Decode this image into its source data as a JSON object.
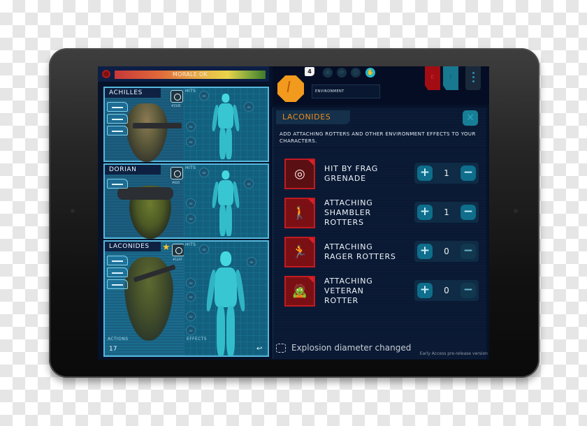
{
  "morale": {
    "label": "MORALE OK"
  },
  "characters": [
    {
      "name": "ACHILLES",
      "perk_id": "#1545",
      "starred": false,
      "weapons": [
        "pistol",
        "assault-rifle",
        "sniper-rifle"
      ],
      "hits_label": "HITS"
    },
    {
      "name": "DORIAN",
      "perk_id": "#635",
      "starred": false,
      "weapons": [
        "pistol"
      ],
      "hits_label": "HITS"
    },
    {
      "name": "LACONIDES",
      "perk_id": "#1247",
      "starred": true,
      "weapons": [
        "assault-rifle",
        "pistol",
        "sniper-rifle"
      ],
      "hits_label": "HITS",
      "actions_label": "ACTIONS",
      "actions_value": "17",
      "effects_label": "EFFECTS"
    }
  ],
  "topbar": {
    "action_points": "4",
    "environment_label": "ENVIRONMENT",
    "tool_icons": [
      "grenade-icon",
      "refresh-icon",
      "character-icon",
      "hand-icon"
    ],
    "flags": [
      {
        "label": "E",
        "color": "#a10d13"
      },
      {
        "label": "!",
        "color": "#17788f"
      }
    ]
  },
  "panel": {
    "title": "LACONIDES",
    "description": "ADD ATTACHING ROTTERS AND OTHER ENVIRONMENT EFFECTS TO YOUR CHARACTERS.",
    "effects": [
      {
        "label_lines": [
          "HIT BY FRAG",
          "GRENADE"
        ],
        "value": "1",
        "icon": "frag-grenade-icon"
      },
      {
        "label_lines": [
          "ATTACHING",
          "SHAMBLER",
          "ROTTERS"
        ],
        "value": "1",
        "icon": "shambler-rotter-icon"
      },
      {
        "label_lines": [
          "ATTACHING",
          "RAGER ROTTERS"
        ],
        "value": "0",
        "icon": "rager-rotter-icon"
      },
      {
        "label_lines": [
          "ATTACHING",
          "VETERAN",
          "ROTTER"
        ],
        "value": "0",
        "icon": "veteran-rotter-icon"
      }
    ]
  },
  "toast": {
    "text": "Explosion diameter changed"
  },
  "version": "Early Access pre-release version",
  "colors": {
    "accent_orange": "#f19a1d",
    "accent_teal": "#28b7c8",
    "danger_red": "#c11b22"
  }
}
